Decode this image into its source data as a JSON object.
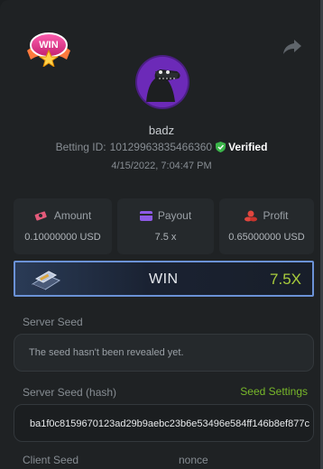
{
  "header": {
    "badge_text": "WIN",
    "username": "badz",
    "betting_id_label": "Betting ID:",
    "betting_id": "10129963835466360",
    "verified_label": "Verified",
    "date": "4/15/2022, 7:04:47 PM"
  },
  "stats": [
    {
      "label": "Amount",
      "value": "0.10000000 USD",
      "icon": "money-icon",
      "color": "#e35a7a"
    },
    {
      "label": "Payout",
      "value": "7.5 x",
      "icon": "card-icon",
      "color": "#8e5ae6"
    },
    {
      "label": "Profit",
      "value": "0.65000000 USD",
      "icon": "coins-icon",
      "color": "#e0463e"
    }
  ],
  "result": {
    "label": "WIN",
    "multiplier": "7.5X"
  },
  "seeds": {
    "server_seed_label": "Server Seed",
    "server_seed_text": "The seed hasn't been revealed yet.",
    "server_hash_label": "Server Seed (hash)",
    "seed_settings_label": "Seed Settings",
    "server_hash": "ba1f0c8159670123ad29b9aebc23b6e53496e584ff146b8ef877c",
    "client_seed_label": "Client Seed",
    "nonce_label": "nonce"
  },
  "colors": {
    "accent_green": "#78b82a",
    "multiplier": "#a8cc3c",
    "avatar_bg": "#6c2ab8",
    "verified_green": "#3bb54a"
  }
}
